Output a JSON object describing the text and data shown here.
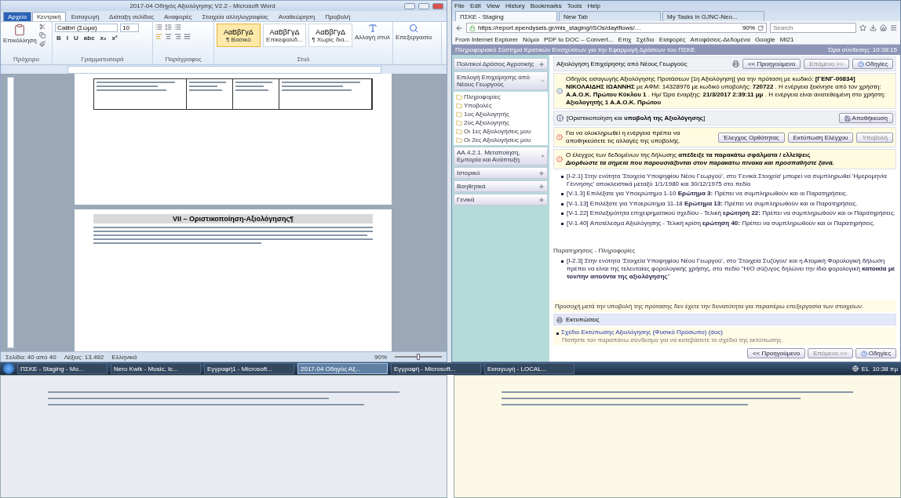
{
  "word": {
    "title": "2017-04 Οδηγός Αξιολόγησης V2.2 - Microsoft Word",
    "tabs": [
      {
        "label": "Αρχείο",
        "selected": false,
        "kind": "file"
      },
      {
        "label": "Κεντρική",
        "selected": true,
        "kind": "tab"
      },
      {
        "label": "Εισαγωγή",
        "selected": false,
        "kind": "tab"
      },
      {
        "label": "Διάταξη σελίδας",
        "selected": false,
        "kind": "tab"
      },
      {
        "label": "Αναφορές",
        "selected": false,
        "kind": "tab"
      },
      {
        "label": "Στοιχεία αλληλογραφίας",
        "selected": false,
        "kind": "tab"
      },
      {
        "label": "Αναθεώρηση",
        "selected": false,
        "kind": "tab"
      },
      {
        "label": "Προβολή",
        "selected": false,
        "kind": "tab"
      }
    ],
    "paste": "Επικόλληση",
    "font": "Calibri (Σώμα)",
    "size": "10",
    "format_buttons": [
      "B",
      "I",
      "U",
      "abc",
      "x₂",
      "x²"
    ],
    "styles": [
      {
        "sample": "ΑαΒβΓγΔ",
        "name": "¶ Βασικό",
        "selected": true
      },
      {
        "sample": "ΑαΒβΓγΔ",
        "name": "Επικεφαλίδ...",
        "selected": false
      },
      {
        "sample": "ΑαΒβΓγΔ",
        "name": "¶ Χωρίς δια...",
        "selected": false
      }
    ],
    "change_styles": "Αλλαγή στυλ",
    "editing": "Επεξεργασία",
    "groups": [
      "Πρόχειρο",
      "Γραμματοσειρά",
      "Παράγραφος",
      "Στυλ"
    ],
    "heading": "VII – Οριστικοποίηση-Αξιολόγησης¶",
    "status": [
      "Σελίδα: 40 από 40",
      "Λέξεις: 13.492",
      "Ελληνικά"
    ],
    "zoom": "90%",
    "zoom_slider": {
      "level": 0.5
    }
  },
  "browser": {
    "menu": [
      "File",
      "Edit",
      "View",
      "History",
      "Bookmarks",
      "Tools",
      "Help"
    ],
    "tabs": [
      {
        "label": "ΠΣΚΕ - Staging",
        "selected": true
      },
      {
        "label": "New Tab",
        "selected": false
      },
      {
        "label": "My Tasks in GJNC-Neo...",
        "selected": false
      }
    ],
    "url": "https://report.ependyseis.gr/mis_staging/ISOs/daytflows/…",
    "zoom": "90%",
    "search_placeholder": "Search",
    "bookmarks": [
      "From Internet Explorer",
      "Νόμοι",
      "PDF to DOC – Convert...",
      "Επιχ",
      "Σχέδιο",
      "Εισφορές",
      "Αποφάσεις-Δεδομένα",
      "Google",
      "ΜΙ21"
    ],
    "app_title": "Πληροφοριακό Σύστημα Κρατικών Ενισχύσεων για την Εφαρμογή Δράσεων του ΠΣΚΕ",
    "login_time": "Ώρα σύνδεσης: 10:38:15",
    "sidebar": [
      {
        "label": "Πολιτικοί Δράσεις Αγροτικής",
        "expanded": false
      },
      {
        "label": "Επιλογή Επιχείρησης από Νέους Γεωργούς",
        "expanded": true,
        "children": [
          {
            "label": "Πληροφορίες"
          },
          {
            "label": "Υποβολές"
          },
          {
            "label": "1ος Αξιολογητής"
          },
          {
            "label": "2ος Αξιολογητής"
          },
          {
            "label": "Οι 1ες Αξιολογήσεις μου"
          },
          {
            "label": "Οι 2ες Αξιολογήσεις μου"
          }
        ]
      },
      {
        "label": "ΑΑ.4.2.1. Μεταποίηση, Εμπορία και Ανάπτυξη",
        "expanded": false
      },
      {
        "label": "Ιστορικό",
        "expanded": false
      },
      {
        "label": "Βοηθητικά",
        "expanded": false
      },
      {
        "label": "Γενικά",
        "expanded": false
      }
    ],
    "page_title": "Αξιολόγηση Επιχείρησης από Νέους Γεωργούς",
    "nav_top": {
      "prev": "<< Προηγούμενο",
      "next": "Επόμενο >>",
      "help": "Οδηγίες"
    },
    "info": "Οδηγός εισαγωγής Αξιολόγησης Προτάσεων [1η Αξιολόγηση] για την πρόταση με κωδικό: **[ΓΕΝΓ-00834] ΝΙΚΟΛΑΙΔΗΣ ΙΩΑΝΝΗΣ** με ΑΦΜ: 14328976 με κωδικό υποβολής: **720722** . Η ενέργεια ξεκίνησε από τον χρήστη: **Α.Α.Ο.Κ. Πρώτου Κύκλου 1** . Ημ/ Ώρα έναρξης: **21/3/2017 2:39:11 μμ** . Η ενέργεια είναι ανατεθειμένη στο χρήστη: **Αξιολογητής 1 Α.Α.Ο.Κ. Πρώτου**",
    "step_title": "[Οριστικοποίηση και **υποβολή της Αξιολόγησης**]",
    "save": "Αποθήκευση",
    "warning": "Για να ολοκληρωθεί η ενέργεια πρέπει να αποθηκεύσετε τις αλλαγές της υποβολής.",
    "actions": [
      {
        "label": "Έλεγχος Ορθότητας",
        "disabled": false
      },
      {
        "label": "Εκτύπωση Ελέγχου",
        "disabled": false
      },
      {
        "label": "Υποβολή",
        "disabled": true
      }
    ],
    "error_1": "Ο έλεγχος των δεδομένων της δήλωσης **απέδειξε τα παρακάτω σφάλματα / ελλείψεις**",
    "error_2": "Διορθώστε τα σημεία που παρουσιάζονται στον παρακάτω πίνακα και προσπαθήστε ξανά.",
    "errors": [
      "[Ι-2.1] Στην ενότητα 'Στοιχεία Υποψηφίου Νέου Γεωργού', στο 'Γενικά Στοιχεία' μπορεί να συμπληρωθεί 'Ημερομηνία Γέννησης' αποκλειστικά μεταξύ 1/1/1980 και 30/12/1975 στο πεδίο",
      "[V-1.3] Επιλέξατε για Υποερώτημα 1-10 **Ερώτημα 3:** Πρέπει να συμπληρωθούν και οι Παρατηρήσεις.",
      "[V-1.13] Επιλέξατε για Υποερώτημα 11-18 **Ερώτημα 13:** Πρέπει να συμπληρωθούν και οι Παρατηρήσεις.",
      "[V-1.22] Επιλεξιμότητα επιχειρηματικού σχεδίου - Τελική **ερώτηση 22:** Πρέπει να συμπληρωθούν και οι Παρατηρήσεις.",
      "[V-1.40] Αποτέλεσμα Αξιολόγησης - Τελική κρίση **ερώτηση 40:** Πρέπει να συμπληρωθούν και οι Παρατηρήσεις."
    ],
    "notes_title": "Παρατηρήσεις - Πληροφορίες",
    "notes": [
      "[Ι-2.3] Στην ενότητα 'Στοιχεία Υποψηφίου Νέου Γεωργού', στο 'Στοιχεία Συζύγου' και η Ατομική Φορολογική δήλωση πρέπει να είναι της τελευταίας φορολογικής χρήσης, στο πεδίο \"Η/Ο σύζυγος δηλώνει την ίδια φορολογική **κατοικία με τον/την αιτούντα της αξιολόγησης**\""
    ],
    "caution": "Προσοχή μετά την υποβολή της πρότασης δεν έχετε την δυνατότητα για περαιτέρω επεξεργασία των στοιχείων.",
    "prints_title": "Εκτυπώσεις",
    "print_link": "Σχέδιο Εκτύπωσης Αξιολόγησης (Φυσικό Πρόσωπο) (doc)",
    "print_hint": "Πατήστε τον παραπάνω σύνδεσμο για να κατεβάσετε το σχέδιο της εκτύπωσης.",
    "nav_bottom": {
      "prev": "<< Προηγούμενο",
      "next": "Επόμενο >>",
      "help": "Οδηγίες"
    }
  },
  "taskbar": {
    "items": [
      {
        "label": "ΠΣΚΕ - Staging - Mo...",
        "active": false
      },
      {
        "label": "Nero Kwik - Music, Ic...",
        "active": false
      },
      {
        "label": "Εγγραφή1 - Microsoft...",
        "active": false
      },
      {
        "label": "2017-04 Οδηγός Αξ...",
        "active": true
      },
      {
        "label": "Εγγραφή - Microsoft...",
        "active": false
      },
      {
        "label": "Εισαγωγή - LOCAL...",
        "active": false
      }
    ],
    "lang": "EL",
    "time": "10:38 πμ"
  }
}
